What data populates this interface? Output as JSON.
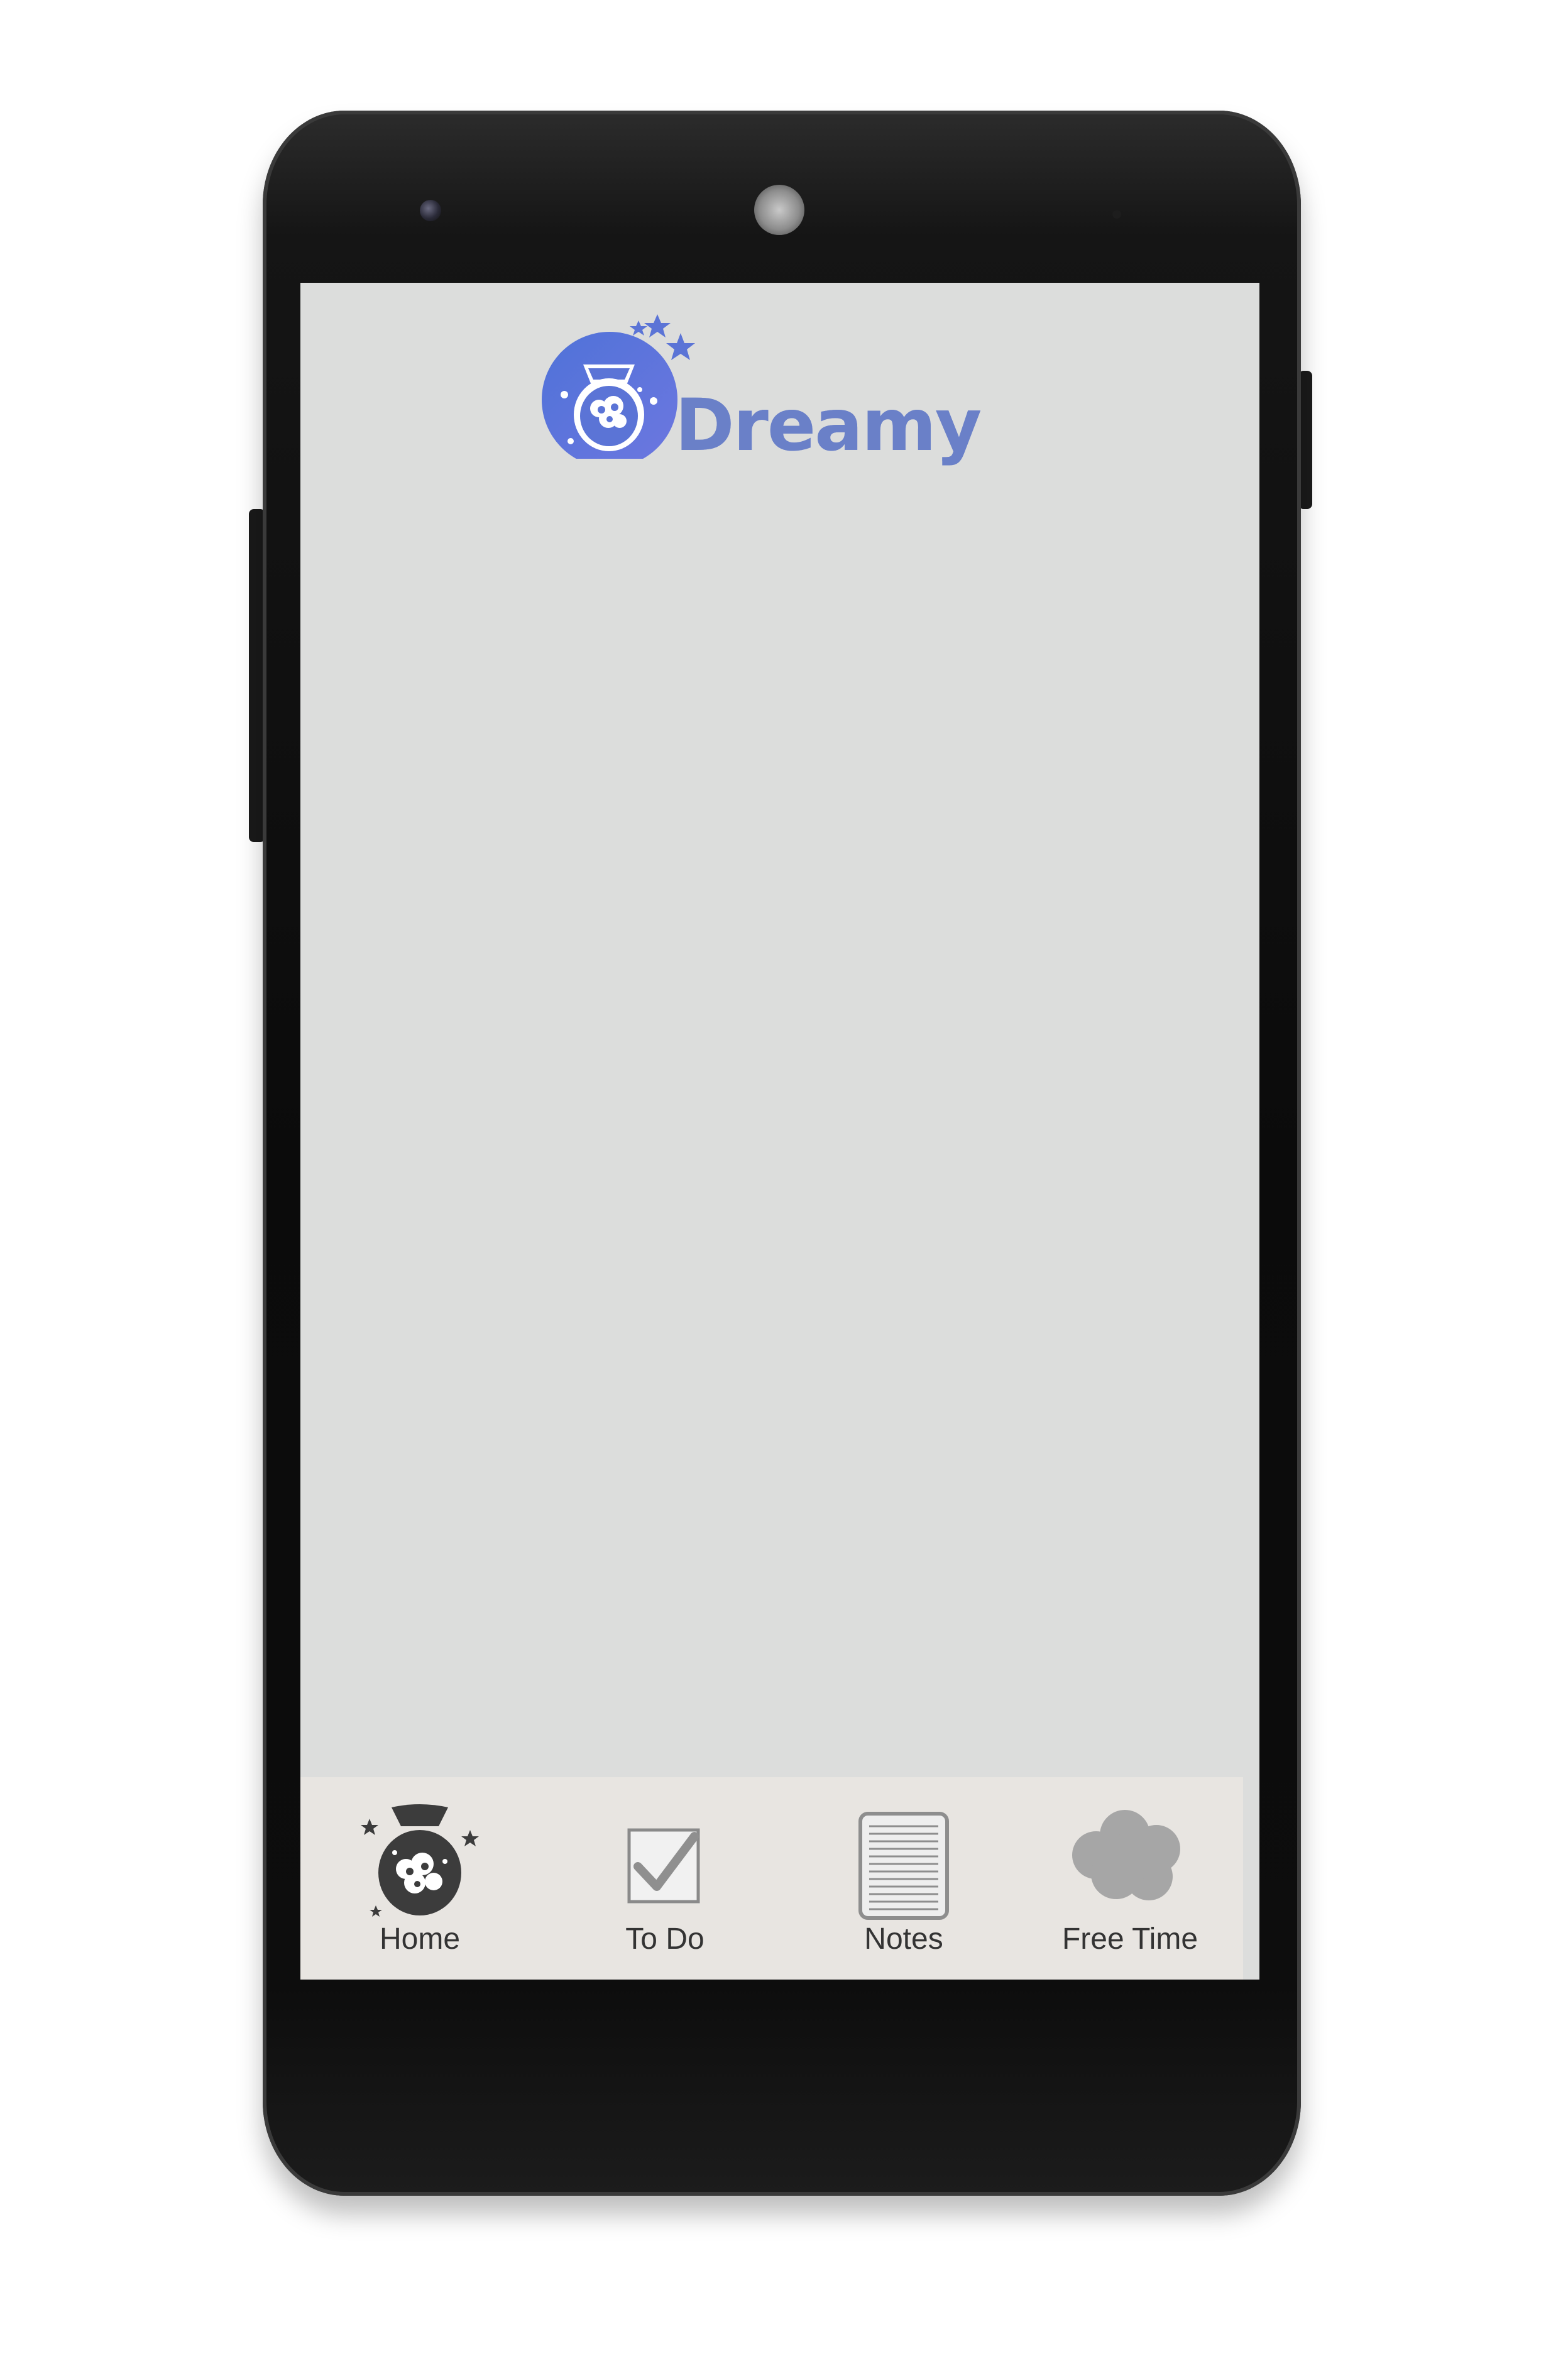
{
  "app": {
    "title": "Dreamy"
  },
  "tabs": [
    {
      "label": "Home",
      "icon": "dream-jar-icon"
    },
    {
      "label": "To Do",
      "icon": "checkbox-icon"
    },
    {
      "label": "Notes",
      "icon": "notepad-icon"
    },
    {
      "label": "Free Time",
      "icon": "cloud-icon"
    }
  ],
  "colors": {
    "screen_background": "#dcdddc",
    "tab_bar_background": "#e8e5e1",
    "brand_blue": "#5b74d6",
    "brand_text": "#6a80c8",
    "icon_dark": "#3c3c3c",
    "icon_gray": "#9a9a9a"
  }
}
